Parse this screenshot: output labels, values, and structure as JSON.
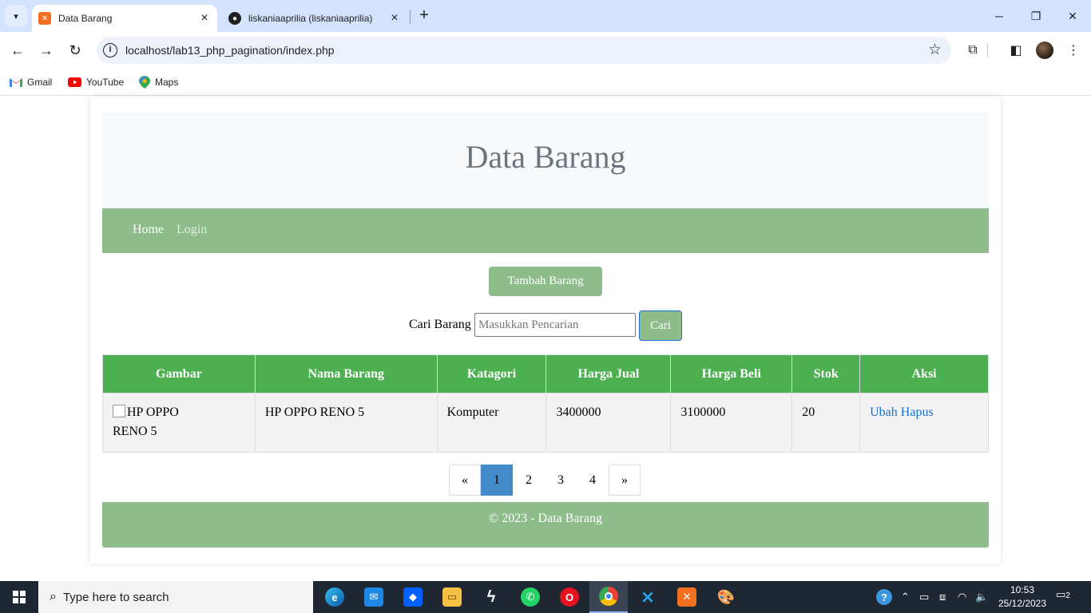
{
  "browser": {
    "tabs": [
      {
        "title": "Data Barang",
        "favicon": "xampp-icon",
        "active": true
      },
      {
        "title": "liskaniaaprilia (liskaniaaprilia)",
        "favicon": "github-icon",
        "active": false
      }
    ],
    "url": "localhost/lab13_php_pagination/index.php",
    "bookmarks": [
      {
        "label": "Gmail"
      },
      {
        "label": "YouTube"
      },
      {
        "label": "Maps"
      }
    ]
  },
  "page": {
    "title": "Data Barang",
    "nav": {
      "home": "Home",
      "login": "Login"
    },
    "add_button": "Tambah Barang",
    "search": {
      "label": "Cari Barang",
      "placeholder": "Masukkan Pencarian",
      "value": "",
      "button": "Cari"
    },
    "table": {
      "headers": [
        "Gambar",
        "Nama Barang",
        "Katagori",
        "Harga Jual",
        "Harga Beli",
        "Stok",
        "Aksi"
      ],
      "rows": [
        {
          "image_alt": "HP OPPO RENO 5",
          "nama": "HP OPPO RENO 5",
          "kategori": "Komputer",
          "harga_jual": "3400000",
          "harga_beli": "3100000",
          "stok": "20",
          "edit": "Ubah",
          "delete": "Hapus"
        }
      ]
    },
    "pagination": {
      "prev": "«",
      "pages": [
        "1",
        "2",
        "3",
        "4"
      ],
      "current": "1",
      "next": "»"
    },
    "footer": "© 2023 - Data Barang"
  },
  "taskbar": {
    "search_placeholder": "Type here to search",
    "time": "10:53",
    "date": "25/12/2023",
    "notification_count": "2"
  },
  "colors": {
    "accent_green": "#8fbc8b",
    "table_header": "#4caf50",
    "active_page": "#428bca",
    "link": "#1a6fd0"
  }
}
